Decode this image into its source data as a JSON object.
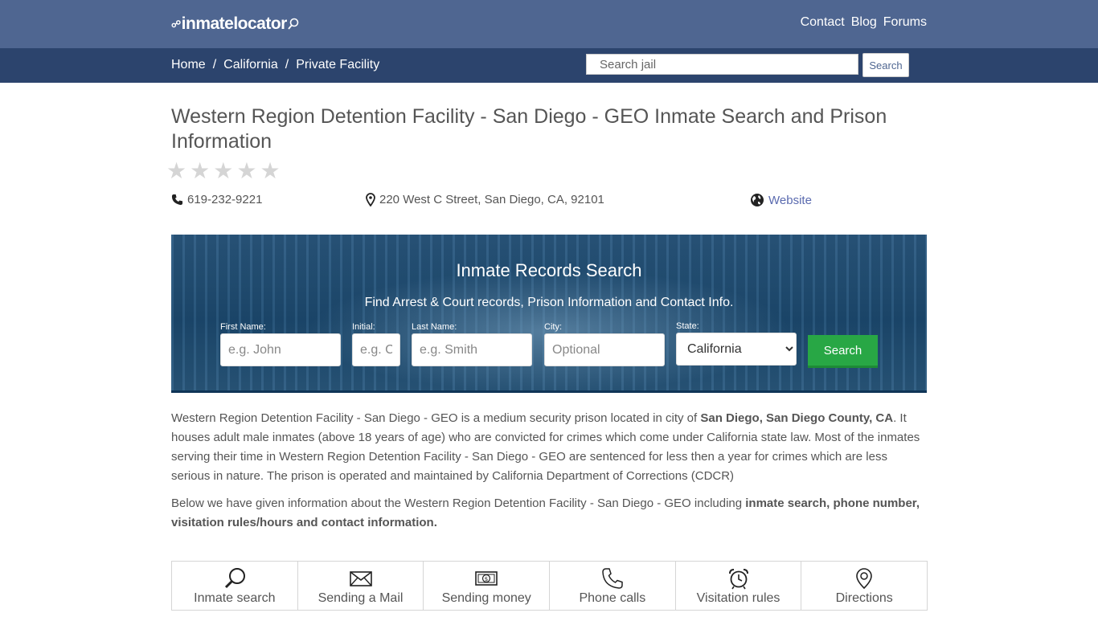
{
  "header": {
    "logo": "inmatelocator",
    "nav": [
      "Contact",
      "Blog",
      "Forums"
    ]
  },
  "breadcrumb": [
    "Home",
    "California",
    "Private Facility"
  ],
  "breadcrumb_separator": "/",
  "jail_search": {
    "placeholder": "Search jail",
    "button": "Search"
  },
  "facility": {
    "title": "Western Region Detention Facility - San Diego - GEO Inmate Search and Prison Information",
    "rating": {
      "filled": 0,
      "max": 5
    },
    "phone": "619-232-9221",
    "address": "220 West C Street, San Diego, CA, 92101",
    "website_label": "Website"
  },
  "records_search": {
    "title": "Inmate Records Search",
    "subtitle": "Find Arrest & Court records, Prison Information and Contact Info.",
    "first_name": {
      "label": "First Name:",
      "placeholder": "e.g. John"
    },
    "initial": {
      "label": "Initial:",
      "placeholder": "e.g. C"
    },
    "last_name": {
      "label": "Last Name:",
      "placeholder": "e.g. Smith"
    },
    "city": {
      "label": "City:",
      "placeholder": "Optional"
    },
    "state": {
      "label": "State:",
      "selected": "California"
    },
    "button": "Search"
  },
  "description": {
    "p1_a": "Western Region Detention Facility - San Diego - GEO is a medium security prison located in city of ",
    "p1_bold": "San Diego, San Diego County, CA",
    "p1_b": ". It houses adult male inmates (above 18 years of age) who are convicted for crimes which come under California state law. Most of the inmates serving their time in Western Region Detention Facility - San Diego - GEO are sentenced for less then a year for crimes which are less serious in nature. The prison is operated and maintained by California Department of Corrections (CDCR)",
    "p2_a": "Below we have given information about the Western Region Detention Facility - San Diego - GEO including ",
    "p2_bold": "inmate search, phone number, visitation rules/hours and contact information."
  },
  "tiles": [
    {
      "label": "Inmate search",
      "icon": "magnifier-icon"
    },
    {
      "label": "Sending a Mail",
      "icon": "envelope-icon"
    },
    {
      "label": "Sending money",
      "icon": "banknote-icon"
    },
    {
      "label": "Phone calls",
      "icon": "phone-icon"
    },
    {
      "label": "Visitation rules",
      "icon": "alarm-clock-icon"
    },
    {
      "label": "Directions",
      "icon": "map-pin-icon"
    }
  ],
  "colors": {
    "topbar": "#4f6691",
    "crumbbar": "#2c446d",
    "search_button": "#28a745",
    "link": "#5a6aaf"
  }
}
